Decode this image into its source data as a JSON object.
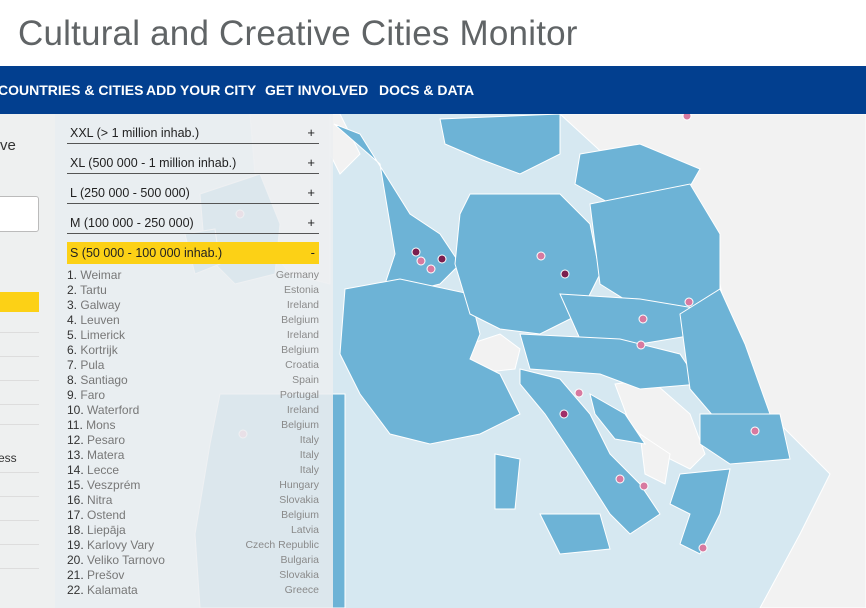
{
  "header": {
    "title": "Cultural and Creative Cities Monitor"
  },
  "nav": [
    {
      "label": "COUNTRIES & CITIES"
    },
    {
      "label": "ADD YOUR CITY"
    },
    {
      "label": "GET INVOLVED"
    },
    {
      "label": "DOCS & DATA"
    }
  ],
  "left_panel": {
    "text_fragment": "ve",
    "item_fragment": "ess"
  },
  "categories": [
    {
      "label": "XXL (> 1 million inhab.)",
      "sign": "+"
    },
    {
      "label": "XL (500 000 - 1 million inhab.)",
      "sign": "+"
    },
    {
      "label": "L (250 000 - 500 000)",
      "sign": "+"
    },
    {
      "label": "M (100 000 - 250 000)",
      "sign": "+"
    },
    {
      "label": "S (50 000 - 100 000 inhab.)",
      "sign": "-"
    }
  ],
  "cities": [
    {
      "rank": "1.",
      "name": "Weimar",
      "country": "Germany"
    },
    {
      "rank": "2.",
      "name": "Tartu",
      "country": "Estonia"
    },
    {
      "rank": "3.",
      "name": "Galway",
      "country": "Ireland"
    },
    {
      "rank": "4.",
      "name": "Leuven",
      "country": "Belgium"
    },
    {
      "rank": "5.",
      "name": "Limerick",
      "country": "Ireland"
    },
    {
      "rank": "6.",
      "name": "Kortrijk",
      "country": "Belgium"
    },
    {
      "rank": "7.",
      "name": "Pula",
      "country": "Croatia"
    },
    {
      "rank": "8.",
      "name": "Santiago",
      "country": "Spain"
    },
    {
      "rank": "9.",
      "name": "Faro",
      "country": "Portugal"
    },
    {
      "rank": "10.",
      "name": "Waterford",
      "country": "Ireland"
    },
    {
      "rank": "11.",
      "name": "Mons",
      "country": "Belgium"
    },
    {
      "rank": "12.",
      "name": "Pesaro",
      "country": "Italy"
    },
    {
      "rank": "13.",
      "name": "Matera",
      "country": "Italy"
    },
    {
      "rank": "14.",
      "name": "Lecce",
      "country": "Italy"
    },
    {
      "rank": "15.",
      "name": "Veszprém",
      "country": "Hungary"
    },
    {
      "rank": "16.",
      "name": "Nitra",
      "country": "Slovakia"
    },
    {
      "rank": "17.",
      "name": "Ostend",
      "country": "Belgium"
    },
    {
      "rank": "18.",
      "name": "Liepāja",
      "country": "Latvia"
    },
    {
      "rank": "19.",
      "name": "Karlovy Vary",
      "country": "Czech Republic"
    },
    {
      "rank": "20.",
      "name": "Veliko Tarnovo",
      "country": "Bulgaria"
    },
    {
      "rank": "21.",
      "name": "Prešov",
      "country": "Slovakia"
    },
    {
      "rank": "22.",
      "name": "Kalamata",
      "country": "Greece"
    }
  ],
  "colors": {
    "nav_bg": "#023f8f",
    "active_category": "#fcd116",
    "eu_land": "#6db3d6",
    "non_eu_land": "#f2f2f2",
    "sea": "#d6e8f1",
    "marker_light": "#d77aa0",
    "marker_dark": "#7b1f4f"
  }
}
